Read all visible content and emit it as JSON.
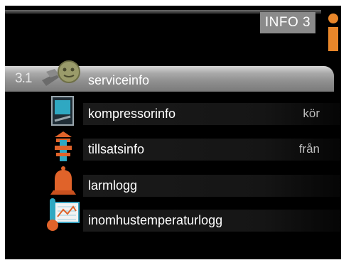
{
  "header": {
    "title": "INFO 3",
    "icon": "info-icon",
    "accent": "#e8862a"
  },
  "menu": {
    "selected_number": "3.1",
    "items": [
      {
        "label": "serviceinfo",
        "status": "",
        "icon": "service-icon",
        "selected": true
      },
      {
        "label": "kompressorinfo",
        "status": "kör",
        "icon": "compressor-icon",
        "selected": false
      },
      {
        "label": "tillsatsinfo",
        "status": "från",
        "icon": "addition-heat-icon",
        "selected": false
      },
      {
        "label": "larmlogg",
        "status": "",
        "icon": "alarm-bell-icon",
        "selected": false
      },
      {
        "label": "inomhustemperaturlogg",
        "status": "",
        "icon": "indoor-temperature-log-icon",
        "selected": false
      }
    ]
  }
}
